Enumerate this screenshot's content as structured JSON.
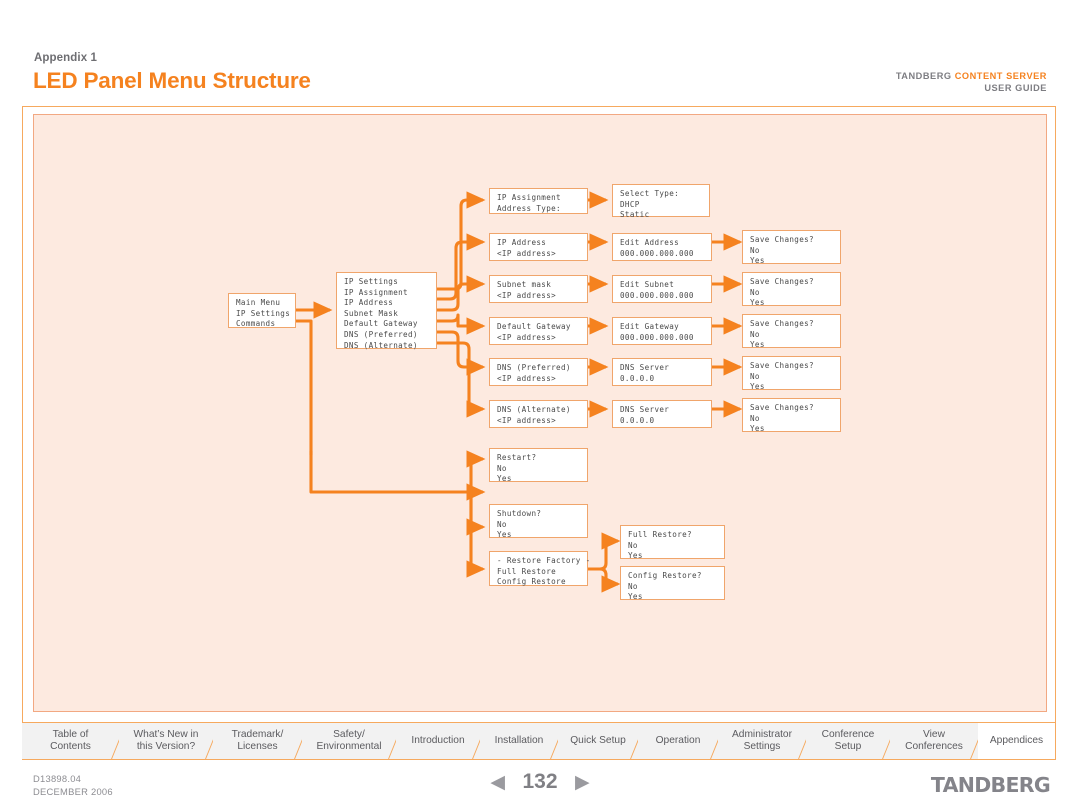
{
  "header": {
    "appendix_label": "Appendix 1",
    "title": "LED Panel Menu Structure",
    "brand_prefix": "TANDBERG ",
    "brand_accent": "CONTENT SERVER",
    "brand_sub": "USER GUIDE",
    "accent_color": "#F5821F"
  },
  "diagram": {
    "panel_fill": "#FDEAE0",
    "connector_color": "#F5821F",
    "node_border": "#F0A56B",
    "nodes": {
      "main_menu": "Main Menu\nIP Settings\nCommands",
      "ip_settings": "IP Settings\nIP Assignment\nIP Address\nSubnet Mask\nDefault Gateway\nDNS (Preferred)\nDNS (Alternate)",
      "ip_assignment": "IP Assignment\nAddress Type:",
      "select_type": "Select Type:\nDHCP\nStatic",
      "ip_address": "IP Address\n<IP address>",
      "edit_address": "Edit Address\n000.000.000.000",
      "save_address": "Save Changes?\nNo\nYes",
      "subnet_mask": "Subnet mask\n<IP address>",
      "edit_subnet": "Edit Subnet\n000.000.000.000",
      "save_subnet": "Save Changes?\nNo\nYes",
      "default_gateway": "Default Gateway\n<IP address>",
      "edit_gateway": "Edit Gateway\n000.000.000.000",
      "save_gateway": "Save Changes?\nNo\nYes",
      "dns_preferred": "DNS (Preferred)\n<IP address>",
      "dns_server_pref": "DNS Server\n0.0.0.0",
      "save_dns_pref": "Save Changes?\nNo\nYes",
      "dns_alternate": "DNS (Alternate)\n<IP address>",
      "dns_server_alt": "DNS Server\n0.0.0.0",
      "save_dns_alt": "Save Changes?\nNo\nYes",
      "restart": "Restart?\nNo\nYes",
      "shutdown": "Shutdown?\nNo\nYes",
      "restore_factory": "- Restore Factory -\nFull Restore\nConfig Restore",
      "full_restore": "Full Restore?\nNo\nYes",
      "config_restore": "Config Restore?\nNo\nYes"
    }
  },
  "tabs": [
    {
      "label": "Table of\nContents",
      "line1": "Table of",
      "line2": "Contents",
      "active": false
    },
    {
      "label": "What's New in\nthis Version?",
      "line1": "What’s New in",
      "line2": "this Version?",
      "active": false
    },
    {
      "label": "Trademark/\nLicenses",
      "line1": "Trademark/",
      "line2": "Licenses",
      "active": false
    },
    {
      "label": "Safety/\nEnvironmental",
      "line1": "Safety/",
      "line2": "Environmental",
      "active": false
    },
    {
      "label": "Introduction",
      "line1": "Introduction",
      "line2": "",
      "active": false
    },
    {
      "label": "Installation",
      "line1": "Installation",
      "line2": "",
      "active": false
    },
    {
      "label": "Quick Setup",
      "line1": "Quick Setup",
      "line2": "",
      "active": false
    },
    {
      "label": "Operation",
      "line1": "Operation",
      "line2": "",
      "active": false
    },
    {
      "label": "Administrator\nSettings",
      "line1": "Administrator",
      "line2": "Settings",
      "active": false
    },
    {
      "label": "Conference\nSetup",
      "line1": "Conference",
      "line2": "Setup",
      "active": false
    },
    {
      "label": "View\nConferences",
      "line1": "View",
      "line2": "Conferences",
      "active": false
    },
    {
      "label": "Appendices",
      "line1": "Appendices",
      "line2": "",
      "active": true
    }
  ],
  "footer": {
    "doc_id": "D13898.04",
    "doc_date": "DECEMBER 2006",
    "prev_arrow": "◀",
    "next_arrow": "▶",
    "page_number": "132",
    "logo": "TANDBERG"
  }
}
